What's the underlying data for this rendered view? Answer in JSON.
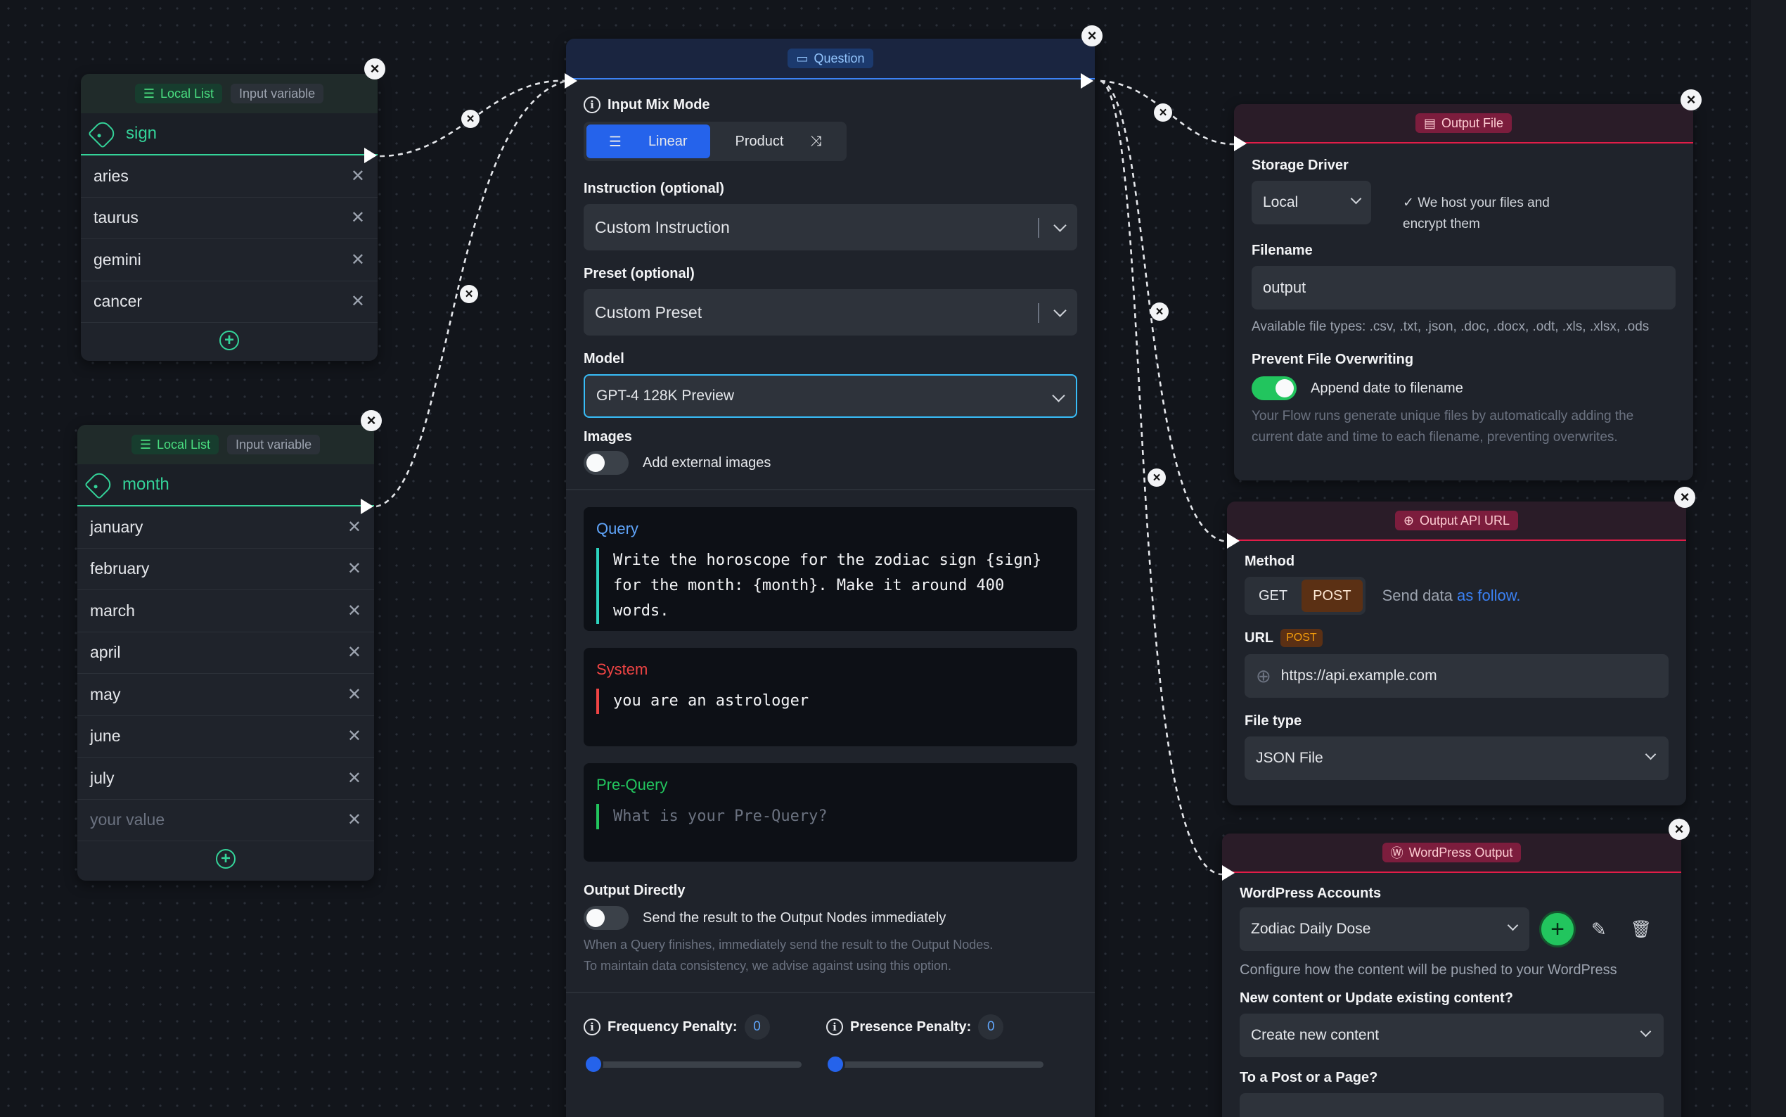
{
  "local_list_1": {
    "badge": "Local List",
    "tag": "Input variable",
    "variable": "sign",
    "items": [
      "aries",
      "taurus",
      "gemini",
      "cancer"
    ]
  },
  "local_list_2": {
    "badge": "Local List",
    "tag": "Input variable",
    "variable": "month",
    "items": [
      "january",
      "february",
      "march",
      "april",
      "may",
      "june",
      "july"
    ],
    "placeholder": "your value"
  },
  "question": {
    "badge": "Question",
    "input_mix_mode_label": "Input Mix Mode",
    "mode_linear": "Linear",
    "mode_product": "Product",
    "instruction_label": "Instruction (optional)",
    "instruction_value": "Custom Instruction",
    "preset_label": "Preset (optional)",
    "preset_value": "Custom Preset",
    "model_label": "Model",
    "model_value": "GPT-4 128K Preview",
    "images_label": "Images",
    "images_toggle": "Add external images",
    "query_title": "Query",
    "query_line1": "Write the horoscope for the zodiac sign {sign}",
    "query_line2": "for the month: {month}. Make it around 400 words.",
    "system_title": "System",
    "system_text": "you are an astrologer",
    "prequery_title": "Pre-Query",
    "prequery_placeholder": "What is your Pre-Query?",
    "output_directly_label": "Output Directly",
    "output_directly_toggle": "Send the result to the Output Nodes immediately",
    "hint_line1": "When a Query finishes, immediately send the result to the Output Nodes.",
    "hint_line2": "To maintain data consistency, we advise against using this option.",
    "frequency_label": "Frequency Penalty:",
    "frequency_value": "0",
    "presence_label": "Presence Penalty:",
    "presence_value": "0",
    "frequency_level": 0,
    "presence_level": 0
  },
  "output_file": {
    "badge": "Output File",
    "storage_label": "Storage Driver",
    "storage_value": "Local",
    "storage_note_line1": "We host your files and",
    "storage_note_line2": "encrypt them",
    "filename_label": "Filename",
    "filename_value": "output",
    "file_types_note": "Available file types: .csv, .txt, .json, .doc, .docx, .odt, .xls, .xlsx, .ods",
    "prevent_label": "Prevent File Overwriting",
    "append_toggle": "Append date to filename",
    "append_hint_line1": "Your Flow runs generate unique files by automatically adding the",
    "append_hint_line2": "current date and time to each filename, preventing overwrites."
  },
  "output_api": {
    "badge": "Output API URL",
    "method_label": "Method",
    "method_get": "GET",
    "method_post": "POST",
    "send_data_prefix": "Send data",
    "send_data_link": "as follow.",
    "url_label": "URL",
    "url_badge": "POST",
    "url_value": "https://api.example.com",
    "filetype_label": "File type",
    "filetype_value": "JSON File"
  },
  "wordpress": {
    "badge": "WordPress Output",
    "accounts_label": "WordPress Accounts",
    "account_value": "Zodiac Daily Dose",
    "configure_note": "Configure how the content will be pushed to your WordPress",
    "new_or_update_label": "New content or Update existing content?",
    "new_or_update_value": "Create new content",
    "post_or_page_label": "To a Post or a Page?"
  },
  "colors": {
    "canvas": "#12151b",
    "node": "#1f232b",
    "input_accent": "#34d399",
    "question_accent": "#3b82f6",
    "output_accent": "#e11d48",
    "system_accent": "#ef4444",
    "prequery_accent": "#22c55e",
    "query_accent": "#2dd4bf"
  }
}
